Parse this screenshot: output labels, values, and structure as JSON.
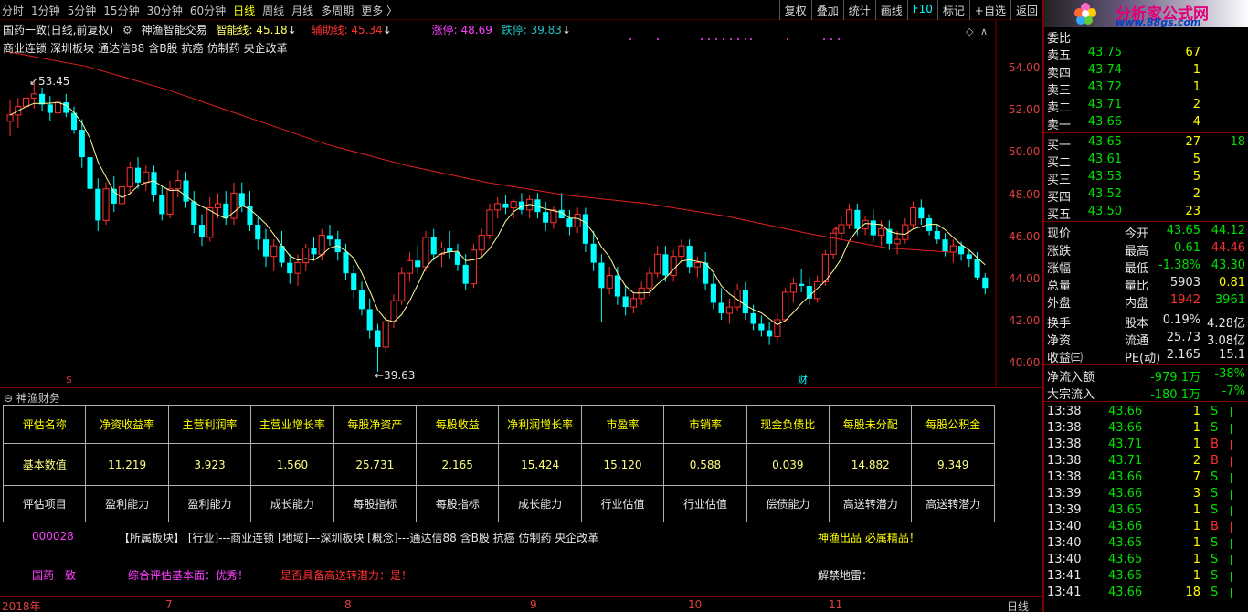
{
  "toolbar": {
    "periods": [
      "分时",
      "1分钟",
      "5分钟",
      "15分钟",
      "30分钟",
      "60分钟",
      "日线",
      "周线",
      "月线",
      "多周期",
      "更多 〉"
    ],
    "active_period": "日线",
    "tools": [
      "复权",
      "叠加",
      "统计",
      "画线",
      "F10",
      "标记",
      "+自选",
      "返回"
    ]
  },
  "chart": {
    "title": "国药一致(日线,前复权)",
    "indicator": "神渔智能交易",
    "zhineng_label": "智能线: 45.18",
    "fuzhu_label": "辅助线: 45.34",
    "zhangting_label": "涨停: 48.69",
    "dieting_label": "跌停: 39.83",
    "concepts": [
      "商业连锁",
      "深圳板块",
      "通达信88",
      "含B股",
      "抗癌",
      "仿制药",
      "央企改革"
    ],
    "high_marker": "53.45",
    "low_marker": "39.63",
    "bottom_marker_left": "$",
    "bottom_marker_right": "财",
    "y_ticks": [
      "54.00",
      "52.00",
      "50.00",
      "48.00",
      "46.00",
      "44.00",
      "42.00",
      "40.00"
    ],
    "colors": {
      "up": "#ff3030",
      "down": "#00ffff",
      "ma_short": "#ffffa0",
      "ma_long": "#e02020"
    }
  },
  "chart_data": {
    "type": "candlestick",
    "ylim": [
      39.5,
      55
    ],
    "y_ticks": [
      54,
      52,
      50,
      48,
      46,
      44,
      42,
      40
    ],
    "x_labels": [
      "2018年",
      "7",
      "8",
      "9",
      "10",
      "11"
    ],
    "candles": [
      [
        51.5,
        52.5,
        50.8,
        51.8
      ],
      [
        51.8,
        52.6,
        51.2,
        52.2
      ],
      [
        52.2,
        53.0,
        51.7,
        52.6
      ],
      [
        52.6,
        53.45,
        52.1,
        52.8
      ],
      [
        52.8,
        53.1,
        52.0,
        52.3
      ],
      [
        52.3,
        52.7,
        51.5,
        51.9
      ],
      [
        51.9,
        52.6,
        51.4,
        52.4
      ],
      [
        52.4,
        52.8,
        51.7,
        51.9
      ],
      [
        51.9,
        52.2,
        50.9,
        51.1
      ],
      [
        51.1,
        51.6,
        49.3,
        49.8
      ],
      [
        49.8,
        50.3,
        47.9,
        48.3
      ],
      [
        48.3,
        48.8,
        46.3,
        46.8
      ],
      [
        46.8,
        48.6,
        46.6,
        48.3
      ],
      [
        48.3,
        48.9,
        47.2,
        47.6
      ],
      [
        47.6,
        48.7,
        47.3,
        48.4
      ],
      [
        48.4,
        49.6,
        48.1,
        49.3
      ],
      [
        49.3,
        49.8,
        48.3,
        48.6
      ],
      [
        48.6,
        49.4,
        48.2,
        49.1
      ],
      [
        49.1,
        49.4,
        47.7,
        48.0
      ],
      [
        48.0,
        48.4,
        46.8,
        47.1
      ],
      [
        47.1,
        48.7,
        46.9,
        48.3
      ],
      [
        48.3,
        49.2,
        47.9,
        48.7
      ],
      [
        48.7,
        49.1,
        47.4,
        47.7
      ],
      [
        47.7,
        48.2,
        46.2,
        46.6
      ],
      [
        46.6,
        47.1,
        45.6,
        46.0
      ],
      [
        46.0,
        47.9,
        45.8,
        47.4
      ],
      [
        47.4,
        48.1,
        46.9,
        47.6
      ],
      [
        47.6,
        48.2,
        46.6,
        46.9
      ],
      [
        46.9,
        48.6,
        46.6,
        48.1
      ],
      [
        48.1,
        48.6,
        47.2,
        47.5
      ],
      [
        47.5,
        48.2,
        46.3,
        46.6
      ],
      [
        46.6,
        47.0,
        45.4,
        45.9
      ],
      [
        45.9,
        46.4,
        44.6,
        45.1
      ],
      [
        45.1,
        45.9,
        44.4,
        45.6
      ],
      [
        45.6,
        46.3,
        44.6,
        44.8
      ],
      [
        44.8,
        45.2,
        43.8,
        44.3
      ],
      [
        44.3,
        45.2,
        43.7,
        44.8
      ],
      [
        44.8,
        45.7,
        44.4,
        45.5
      ],
      [
        45.5,
        46.0,
        44.9,
        45.2
      ],
      [
        45.2,
        46.4,
        44.9,
        46.1
      ],
      [
        46.1,
        46.6,
        45.6,
        45.9
      ],
      [
        45.9,
        46.3,
        44.9,
        45.3
      ],
      [
        45.3,
        45.7,
        44.0,
        44.3
      ],
      [
        44.3,
        44.7,
        43.1,
        43.5
      ],
      [
        43.5,
        43.9,
        42.3,
        42.6
      ],
      [
        42.6,
        43.1,
        41.2,
        41.6
      ],
      [
        41.6,
        41.9,
        39.63,
        40.8
      ],
      [
        40.8,
        42.4,
        40.5,
        42.0
      ],
      [
        42.0,
        43.3,
        41.7,
        43.0
      ],
      [
        43.0,
        44.6,
        42.8,
        44.3
      ],
      [
        44.3,
        45.3,
        43.9,
        44.9
      ],
      [
        44.9,
        45.6,
        44.3,
        44.6
      ],
      [
        44.6,
        46.3,
        44.4,
        46.0
      ],
      [
        46.0,
        46.4,
        44.9,
        45.2
      ],
      [
        45.2,
        45.8,
        44.6,
        45.5
      ],
      [
        45.5,
        46.3,
        45.0,
        45.3
      ],
      [
        45.3,
        45.7,
        44.4,
        44.7
      ],
      [
        44.7,
        45.2,
        43.5,
        43.8
      ],
      [
        43.8,
        45.7,
        43.6,
        45.4
      ],
      [
        45.4,
        46.4,
        45.1,
        46.1
      ],
      [
        46.1,
        47.6,
        45.9,
        47.3
      ],
      [
        47.3,
        47.9,
        46.9,
        47.6
      ],
      [
        47.6,
        48.0,
        47.1,
        47.4
      ],
      [
        47.4,
        47.8,
        46.9,
        47.7
      ],
      [
        47.7,
        48.1,
        47.1,
        47.3
      ],
      [
        47.3,
        48.0,
        46.9,
        47.8
      ],
      [
        47.8,
        48.1,
        46.9,
        47.2
      ],
      [
        47.2,
        47.7,
        46.3,
        46.7
      ],
      [
        46.7,
        47.5,
        46.4,
        47.3
      ],
      [
        47.3,
        48.1,
        46.9,
        46.9
      ],
      [
        46.9,
        47.3,
        46.1,
        46.5
      ],
      [
        46.5,
        47.4,
        46.2,
        47.1
      ],
      [
        47.1,
        47.4,
        45.3,
        45.7
      ],
      [
        45.7,
        46.3,
        44.4,
        44.8
      ],
      [
        44.8,
        45.2,
        42.0,
        43.6
      ],
      [
        43.6,
        44.6,
        43.3,
        44.2
      ],
      [
        44.2,
        44.6,
        42.8,
        43.2
      ],
      [
        43.2,
        43.7,
        42.3,
        42.7
      ],
      [
        42.7,
        43.4,
        42.4,
        43.1
      ],
      [
        43.1,
        43.9,
        42.8,
        43.6
      ],
      [
        43.6,
        44.6,
        43.2,
        44.3
      ],
      [
        44.3,
        45.6,
        44.1,
        45.2
      ],
      [
        45.2,
        45.6,
        43.9,
        44.2
      ],
      [
        44.2,
        45.4,
        43.9,
        45.1
      ],
      [
        45.1,
        45.9,
        44.8,
        45.6
      ],
      [
        45.6,
        45.9,
        44.3,
        44.6
      ],
      [
        44.6,
        45.1,
        44.1,
        44.8
      ],
      [
        44.8,
        45.3,
        43.5,
        43.8
      ],
      [
        43.8,
        44.3,
        42.6,
        42.9
      ],
      [
        42.9,
        43.6,
        42.1,
        42.4
      ],
      [
        42.4,
        43.1,
        41.9,
        42.7
      ],
      [
        42.7,
        43.8,
        42.5,
        43.5
      ],
      [
        43.5,
        43.9,
        42.1,
        42.4
      ],
      [
        42.4,
        42.8,
        41.6,
        41.9
      ],
      [
        41.9,
        42.3,
        41.3,
        41.6
      ],
      [
        41.6,
        42.0,
        40.9,
        41.3
      ],
      [
        41.3,
        42.4,
        41.1,
        42.1
      ],
      [
        42.1,
        43.6,
        42.0,
        43.4
      ],
      [
        43.4,
        44.1,
        42.9,
        43.8
      ],
      [
        43.8,
        44.5,
        43.4,
        43.7
      ],
      [
        43.7,
        44.1,
        42.8,
        43.1
      ],
      [
        43.1,
        44.2,
        42.9,
        43.9
      ],
      [
        43.9,
        45.4,
        43.7,
        45.2
      ],
      [
        45.2,
        46.4,
        45.0,
        46.2
      ],
      [
        46.2,
        47.0,
        45.9,
        46.6
      ],
      [
        46.6,
        47.6,
        46.4,
        47.3
      ],
      [
        47.3,
        47.6,
        46.1,
        46.4
      ],
      [
        46.4,
        47.0,
        46.1,
        46.8
      ],
      [
        46.8,
        47.3,
        45.8,
        46.1
      ],
      [
        46.1,
        46.8,
        45.6,
        46.4
      ],
      [
        46.4,
        46.8,
        45.4,
        45.7
      ],
      [
        45.7,
        46.3,
        45.2,
        45.9
      ],
      [
        45.9,
        46.9,
        45.7,
        46.6
      ],
      [
        46.6,
        47.7,
        46.4,
        47.4
      ],
      [
        47.4,
        47.8,
        46.6,
        46.9
      ],
      [
        46.9,
        47.1,
        46.1,
        46.3
      ],
      [
        46.3,
        46.6,
        45.7,
        45.9
      ],
      [
        45.9,
        46.2,
        45.1,
        45.3
      ],
      [
        45.3,
        45.9,
        44.8,
        45.6
      ],
      [
        45.6,
        45.8,
        44.9,
        45.2
      ],
      [
        45.2,
        45.4,
        44.6,
        45.0
      ],
      [
        45.0,
        45.3,
        44.0,
        44.1
      ],
      [
        44.1,
        44.3,
        43.3,
        43.6
      ]
    ],
    "ma_long_points": [
      [
        0,
        54.8
      ],
      [
        10,
        54.1
      ],
      [
        20,
        53.0
      ],
      [
        30,
        51.7
      ],
      [
        40,
        50.4
      ],
      [
        50,
        49.4
      ],
      [
        60,
        48.6
      ],
      [
        70,
        48.0
      ],
      [
        80,
        47.6
      ],
      [
        90,
        47.0
      ],
      [
        100,
        46.2
      ],
      [
        110,
        45.5
      ],
      [
        118,
        45.3
      ]
    ]
  },
  "finance": {
    "title": "神渔财务",
    "headers": [
      "评估名称",
      "净资收益率",
      "主营利润率",
      "主营业增长率",
      "每股净资产",
      "每股收益",
      "净利润增长率",
      "市盈率",
      "市销率",
      "现金负债比",
      "每股未分配",
      "每股公积金"
    ],
    "values": [
      "基本数值",
      "11.219",
      "3.923",
      "1.560",
      "25.731",
      "2.165",
      "15.424",
      "15.120",
      "0.588",
      "0.039",
      "14.882",
      "9.349"
    ],
    "items": [
      "评估项目",
      "盈利能力",
      "盈利能力",
      "成长能力",
      "每股指标",
      "每股指标",
      "成长能力",
      "行业估值",
      "行业估值",
      "偿债能力",
      "高送转潜力",
      "高送转潜力"
    ],
    "code": "000028",
    "sector_text": "【所属板块】 [行业]---商业连锁 [地域]---深圳板块 [概念]---通达信88 含B股 抗癌 仿制药 央企改革",
    "slogan": "神渔出品 必属精品！",
    "name": "国药一致",
    "eval_text": "综合评估基本面：优秀！",
    "hst_text": "是否具备高送转潜力：是！",
    "jiejin_text": "解禁地雷："
  },
  "datebar": {
    "labels": [
      "2018年",
      "7",
      "8",
      "9",
      "10",
      "11"
    ],
    "right_label": "日线"
  },
  "logo": {
    "title": "分析家公式网",
    "url": "www.88gs.com"
  },
  "quote": {
    "header_partial": "委比",
    "asks": [
      {
        "label": "卖五",
        "price": "43.75",
        "vol": "67"
      },
      {
        "label": "卖四",
        "price": "43.74",
        "vol": "1"
      },
      {
        "label": "卖三",
        "price": "43.72",
        "vol": "1"
      },
      {
        "label": "卖二",
        "price": "43.71",
        "vol": "2"
      },
      {
        "label": "卖一",
        "price": "43.66",
        "vol": "4"
      }
    ],
    "bids": [
      {
        "label": "买一",
        "price": "43.65",
        "vol": "27",
        "chg": "-18"
      },
      {
        "label": "买二",
        "price": "43.61",
        "vol": "5",
        "chg": ""
      },
      {
        "label": "买三",
        "price": "43.53",
        "vol": "5",
        "chg": ""
      },
      {
        "label": "买四",
        "price": "43.52",
        "vol": "2",
        "chg": ""
      },
      {
        "label": "买五",
        "price": "43.50",
        "vol": "23",
        "chg": ""
      }
    ],
    "stats": [
      {
        "l1": "现价",
        "v1": "43.65",
        "c1": "g",
        "l2": "今开",
        "v2": "44.12",
        "c2": "g"
      },
      {
        "l1": "涨跌",
        "v1": "-0.61",
        "c1": "g",
        "l2": "最高",
        "v2": "44.46",
        "c2": "r"
      },
      {
        "l1": "涨幅",
        "v1": "-1.38%",
        "c1": "g",
        "l2": "最低",
        "v2": "43.30",
        "c2": "g"
      },
      {
        "l1": "总量",
        "v1": "5903",
        "c1": "w",
        "l2": "量比",
        "v2": "0.81",
        "c2": "y"
      },
      {
        "l1": "外盘",
        "v1": "1942",
        "c1": "r",
        "l2": "内盘",
        "v2": "3961",
        "c2": "g"
      }
    ],
    "stats2": [
      {
        "l1": "换手",
        "v1": "0.19%",
        "l2": "股本",
        "v2": "4.28亿"
      },
      {
        "l1": "净资",
        "v1": "25.73",
        "l2": "流通",
        "v2": "3.08亿"
      },
      {
        "l1": "收益㈢",
        "v1": "2.165",
        "l2": "PE(动)",
        "v2": "15.1"
      }
    ],
    "flows": [
      {
        "label": "净流入额",
        "value": "-979.1万",
        "pct": "-38%"
      },
      {
        "label": "大宗流入",
        "value": "-180.1万",
        "pct": "-7%"
      }
    ],
    "ticks": [
      {
        "t": "13:38",
        "p": "43.66",
        "v": "1",
        "s": "S"
      },
      {
        "t": "13:38",
        "p": "43.66",
        "v": "1",
        "s": "S"
      },
      {
        "t": "13:38",
        "p": "43.71",
        "v": "1",
        "s": "B"
      },
      {
        "t": "13:38",
        "p": "43.71",
        "v": "2",
        "s": "B"
      },
      {
        "t": "13:38",
        "p": "43.66",
        "v": "7",
        "s": "S"
      },
      {
        "t": "13:39",
        "p": "43.66",
        "v": "3",
        "s": "S"
      },
      {
        "t": "13:39",
        "p": "43.65",
        "v": "1",
        "s": "S"
      },
      {
        "t": "13:40",
        "p": "43.66",
        "v": "1",
        "s": "B"
      },
      {
        "t": "13:40",
        "p": "43.65",
        "v": "1",
        "s": "S"
      },
      {
        "t": "13:40",
        "p": "43.65",
        "v": "1",
        "s": "S"
      },
      {
        "t": "13:41",
        "p": "43.65",
        "v": "1",
        "s": "S"
      },
      {
        "t": "13:41",
        "p": "43.66",
        "v": "18",
        "s": "S"
      }
    ]
  }
}
